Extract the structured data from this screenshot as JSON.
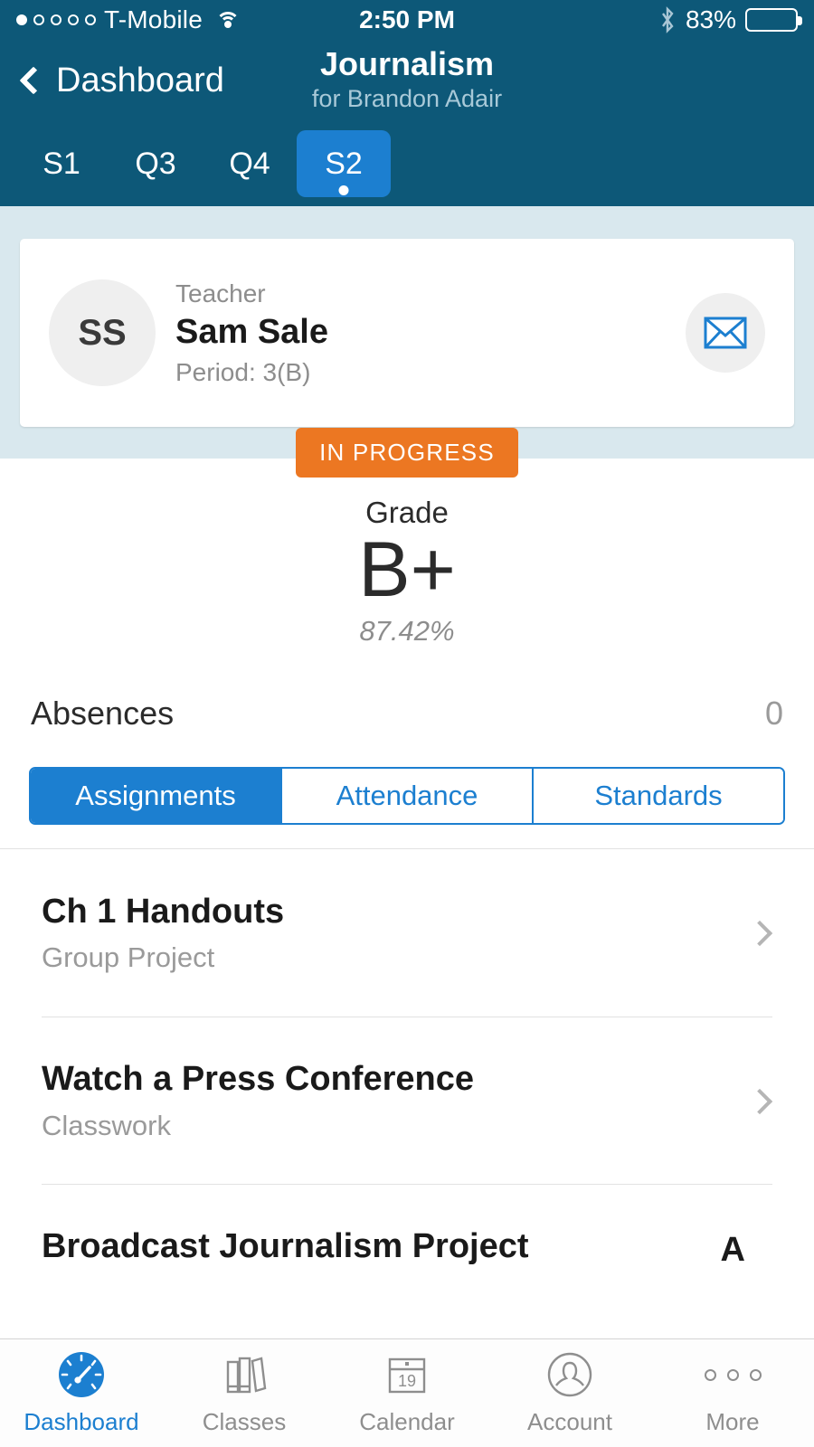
{
  "status_bar": {
    "carrier": "T-Mobile",
    "signal_filled": 1,
    "signal_total": 5,
    "wifi_icon": "wifi-icon",
    "time": "2:50 PM",
    "bluetooth_icon": "bluetooth-icon",
    "battery_percent": "83%",
    "battery_level": 83
  },
  "nav": {
    "back_label": "Dashboard",
    "back_icon": "chevron-left-icon",
    "title": "Journalism",
    "subtitle": "for Brandon Adair"
  },
  "terms": {
    "items": [
      {
        "label": "S1",
        "active": false
      },
      {
        "label": "Q3",
        "active": false
      },
      {
        "label": "Q4",
        "active": false
      },
      {
        "label": "S2",
        "active": true
      }
    ]
  },
  "teacher_card": {
    "initials": "SS",
    "role_label": "Teacher",
    "name": "Sam Sale",
    "period": "Period: 3(B)",
    "mail_icon": "envelope-icon"
  },
  "grade": {
    "status_badge": "IN PROGRESS",
    "label": "Grade",
    "letter": "B+",
    "percent": "87.42%"
  },
  "absences": {
    "label": "Absences",
    "value": "0"
  },
  "segmented": {
    "items": [
      {
        "label": "Assignments",
        "active": true
      },
      {
        "label": "Attendance",
        "active": false
      },
      {
        "label": "Standards",
        "active": false
      }
    ]
  },
  "assignments": [
    {
      "title": "Ch 1 Handouts",
      "category": "Group Project"
    },
    {
      "title": "Watch a Press Conference",
      "category": "Classwork"
    },
    {
      "title": "Broadcast Journalism Project",
      "category": ""
    }
  ],
  "tabbar": [
    {
      "label": "Dashboard",
      "icon": "speedometer-icon",
      "active": true
    },
    {
      "label": "Classes",
      "icon": "books-icon",
      "active": false
    },
    {
      "label": "Calendar",
      "icon": "calendar-icon",
      "active": false,
      "day": "19"
    },
    {
      "label": "Account",
      "icon": "person-circle-icon",
      "active": false
    },
    {
      "label": "More",
      "icon": "ellipsis-icon",
      "active": false
    }
  ],
  "colors": {
    "header": "#0d5878",
    "accent": "#1c7fd0",
    "badge": "#ec7722",
    "band": "#d9e8ee"
  }
}
